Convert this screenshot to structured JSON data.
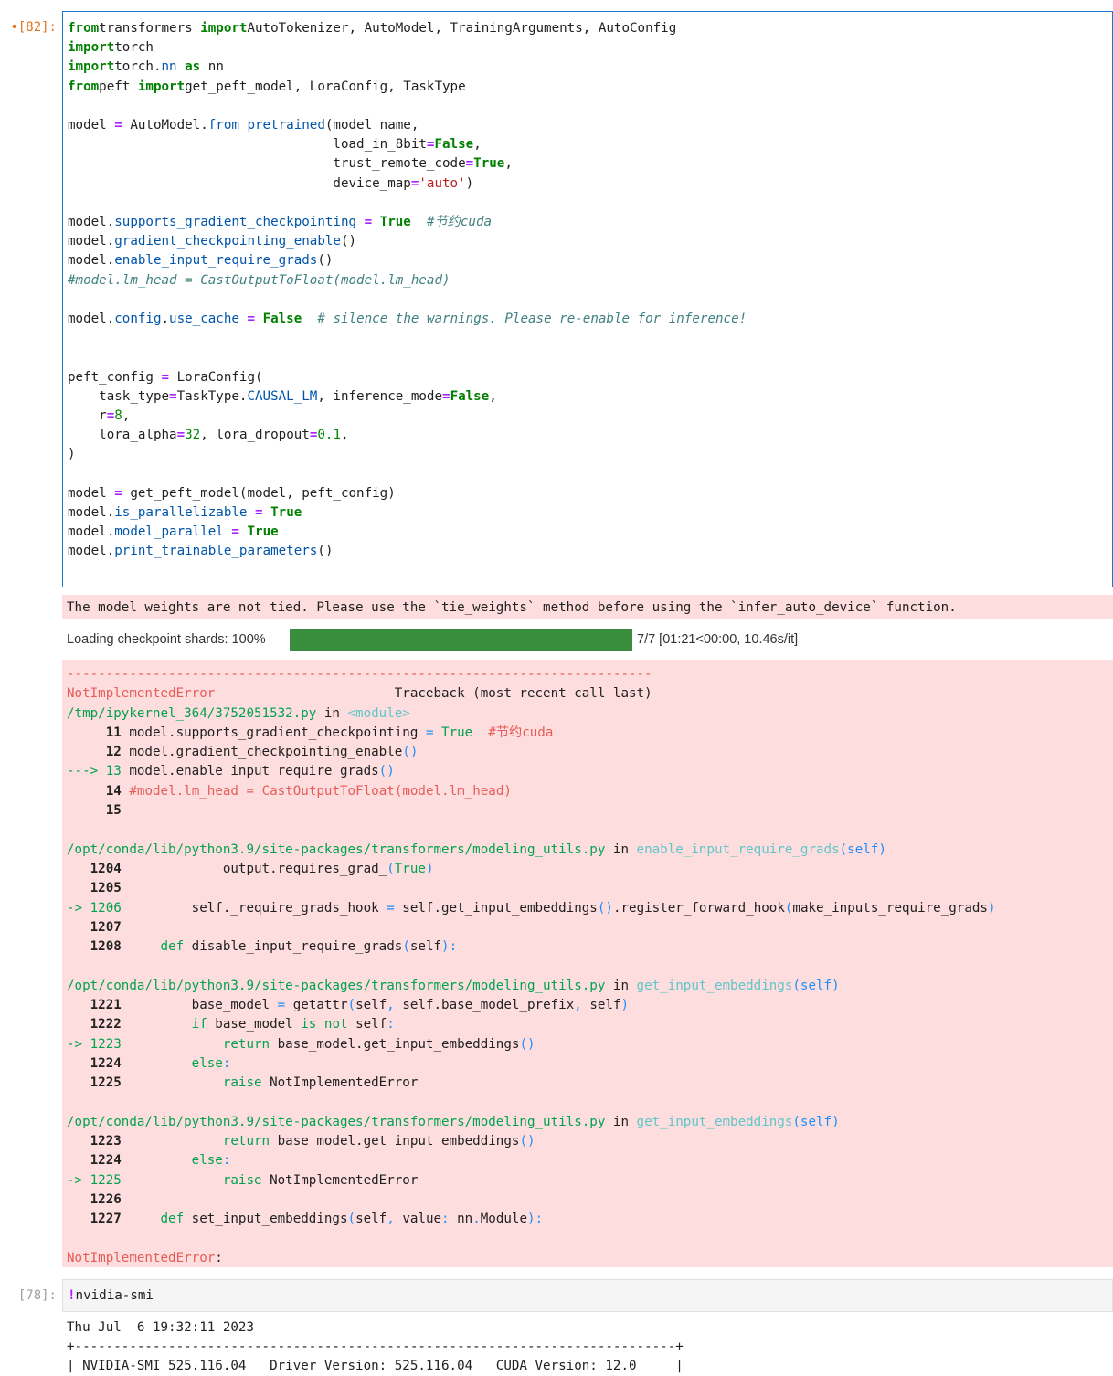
{
  "cell1": {
    "prompt": "[82]:",
    "lines": [
      [
        [
          "kw",
          "from"
        ],
        [
          "",
          "transformers "
        ],
        [
          "kw",
          "import"
        ],
        [
          "",
          "AutoTokenizer, AutoModel, TrainingArguments, AutoConfig"
        ]
      ],
      [
        [
          "kw",
          "import"
        ],
        [
          "",
          "torch"
        ]
      ],
      [
        [
          "kw",
          "import"
        ],
        [
          "",
          "torch."
        ],
        [
          "at",
          "nn"
        ],
        [
          "",
          " "
        ],
        [
          "kw",
          "as"
        ],
        [
          "",
          " nn"
        ]
      ],
      [
        [
          "kw",
          "from"
        ],
        [
          "",
          "peft "
        ],
        [
          "kw",
          "import"
        ],
        [
          "",
          "get_peft_model, LoraConfig, TaskType"
        ]
      ],
      [],
      [
        [
          "",
          "model "
        ],
        [
          "op",
          "="
        ],
        [
          "",
          " AutoModel."
        ],
        [
          "at",
          "from_pretrained"
        ],
        [
          "",
          "(model_name,"
        ]
      ],
      [
        [
          "",
          "                                  load_in_8bit"
        ],
        [
          "op",
          "="
        ],
        [
          "kw",
          "False"
        ],
        [
          "",
          ","
        ]
      ],
      [
        [
          "",
          "                                  trust_remote_code"
        ],
        [
          "op",
          "="
        ],
        [
          "kw",
          "True"
        ],
        [
          "",
          ","
        ]
      ],
      [
        [
          "",
          "                                  device_map"
        ],
        [
          "op",
          "="
        ],
        [
          "st",
          "'auto'"
        ],
        [
          "",
          ")"
        ]
      ],
      [],
      [
        [
          "",
          "model."
        ],
        [
          "at",
          "supports_gradient_checkpointing"
        ],
        [
          "",
          " "
        ],
        [
          "op",
          "="
        ],
        [
          "",
          " "
        ],
        [
          "kw",
          "True"
        ],
        [
          "",
          "  "
        ],
        [
          "cm",
          "#节约cuda"
        ]
      ],
      [
        [
          "",
          "model."
        ],
        [
          "at",
          "gradient_checkpointing_enable"
        ],
        [
          "",
          "()"
        ]
      ],
      [
        [
          "",
          "model."
        ],
        [
          "at",
          "enable_input_require_grads"
        ],
        [
          "",
          "()"
        ]
      ],
      [
        [
          "cm",
          "#model.lm_head = CastOutputToFloat(model.lm_head)"
        ]
      ],
      [],
      [
        [
          "",
          "model."
        ],
        [
          "at",
          "config"
        ],
        [
          "",
          "."
        ],
        [
          "at",
          "use_cache"
        ],
        [
          "",
          " "
        ],
        [
          "op",
          "="
        ],
        [
          "",
          " "
        ],
        [
          "kw",
          "False"
        ],
        [
          "",
          "  "
        ],
        [
          "cm",
          "# silence the warnings. Please re-enable for inference!"
        ]
      ],
      [],
      [],
      [
        [
          "",
          "peft_config "
        ],
        [
          "op",
          "="
        ],
        [
          "",
          " LoraConfig("
        ]
      ],
      [
        [
          "",
          "    task_type"
        ],
        [
          "op",
          "="
        ],
        [
          "",
          "TaskType."
        ],
        [
          "at",
          "CAUSAL_LM"
        ],
        [
          "",
          ", inference_mode"
        ],
        [
          "op",
          "="
        ],
        [
          "kw",
          "False"
        ],
        [
          "",
          ","
        ]
      ],
      [
        [
          "",
          "    r"
        ],
        [
          "op",
          "="
        ],
        [
          "nm",
          "8"
        ],
        [
          "",
          ","
        ]
      ],
      [
        [
          "",
          "    lora_alpha"
        ],
        [
          "op",
          "="
        ],
        [
          "nm",
          "32"
        ],
        [
          "",
          ", lora_dropout"
        ],
        [
          "op",
          "="
        ],
        [
          "nm",
          "0.1"
        ],
        [
          "",
          ","
        ]
      ],
      [
        [
          "",
          ")"
        ]
      ],
      [],
      [
        [
          "",
          "model "
        ],
        [
          "op",
          "="
        ],
        [
          "",
          " get_peft_model(model, peft_config)"
        ]
      ],
      [
        [
          "",
          "model."
        ],
        [
          "at",
          "is_parallelizable"
        ],
        [
          "",
          " "
        ],
        [
          "op",
          "="
        ],
        [
          "",
          " "
        ],
        [
          "kw",
          "True"
        ]
      ],
      [
        [
          "",
          "model."
        ],
        [
          "at",
          "model_parallel"
        ],
        [
          "",
          " "
        ],
        [
          "op",
          "="
        ],
        [
          "",
          " "
        ],
        [
          "kw",
          "True"
        ]
      ],
      [
        [
          "",
          "model."
        ],
        [
          "at",
          "print_trainable_parameters"
        ],
        [
          "",
          "()"
        ]
      ]
    ]
  },
  "warning": "The model weights are not tied. Please use the `tie_weights` method before using the `infer_auto_device` function.",
  "progress": {
    "label": "Loading checkpoint shards: 100%",
    "fraction": 1.0,
    "info": "7/7 [01:21<00:00, 10.46s/it]",
    "color": "#388e3c"
  },
  "traceback": {
    "lines": [
      [
        [
          "rd",
          "---------------------------------------------------------------------------"
        ]
      ],
      [
        [
          "rd",
          "NotImplementedError"
        ],
        [
          "pl",
          "                       Traceback (most recent call last)"
        ]
      ],
      [
        [
          "lg",
          "/tmp/ipykernel_364/3752051532.py"
        ],
        [
          "pl",
          " in "
        ],
        [
          "cy",
          "<module>"
        ]
      ],
      [
        [
          "pl",
          "     "
        ],
        [
          "bo",
          "11"
        ],
        [
          "pl",
          " model.supports_gradient_checkpointing "
        ],
        [
          "gn",
          "="
        ],
        [
          "pl",
          " "
        ],
        [
          "gr",
          "True"
        ],
        [
          "pl",
          "  "
        ],
        [
          "rd",
          "#节约cuda"
        ]
      ],
      [
        [
          "pl",
          "     "
        ],
        [
          "bo",
          "12"
        ],
        [
          "pl",
          " model.gradient_checkpointing_enable"
        ],
        [
          "gn",
          "()"
        ]
      ],
      [
        [
          "gr",
          "---> 13"
        ],
        [
          "pl",
          " model.enable_input_require_grads"
        ],
        [
          "gn",
          "()"
        ]
      ],
      [
        [
          "pl",
          "     "
        ],
        [
          "bo",
          "14"
        ],
        [
          "pl",
          " "
        ],
        [
          "rd",
          "#model.lm_head = CastOutputToFloat(model.lm_head)"
        ]
      ],
      [
        [
          "pl",
          "     "
        ],
        [
          "bo",
          "15"
        ]
      ],
      [],
      [
        [
          "lg",
          "/opt/conda/lib/python3.9/site-packages/transformers/modeling_utils.py"
        ],
        [
          "pl",
          " in "
        ],
        [
          "cy",
          "enable_input_require_grads"
        ],
        [
          "gn",
          "(self)"
        ]
      ],
      [
        [
          "pl",
          "   "
        ],
        [
          "bo",
          "1204"
        ],
        [
          "pl",
          "             output.requires_grad_"
        ],
        [
          "gn",
          "("
        ],
        [
          "gr",
          "True"
        ],
        [
          "gn",
          ")"
        ]
      ],
      [
        [
          "pl",
          "   "
        ],
        [
          "bo",
          "1205"
        ]
      ],
      [
        [
          "gr",
          "-> 1206"
        ],
        [
          "pl",
          "         self._require_grads_hook "
        ],
        [
          "gn",
          "="
        ],
        [
          "pl",
          " self.get_input_embeddings"
        ],
        [
          "gn",
          "()"
        ],
        [
          "pl",
          ".register_forward_hook"
        ],
        [
          "gn",
          "("
        ],
        [
          "pl",
          "make_inputs_require_grads"
        ],
        [
          "gn",
          ")"
        ]
      ],
      [
        [
          "pl",
          "   "
        ],
        [
          "bo",
          "1207"
        ]
      ],
      [
        [
          "pl",
          "   "
        ],
        [
          "bo",
          "1208"
        ],
        [
          "pl",
          "     "
        ],
        [
          "gr",
          "def"
        ],
        [
          "pl",
          " disable_input_require_grads"
        ],
        [
          "gn",
          "("
        ],
        [
          "pl",
          "self"
        ],
        [
          "gn",
          "):"
        ]
      ],
      [],
      [
        [
          "lg",
          "/opt/conda/lib/python3.9/site-packages/transformers/modeling_utils.py"
        ],
        [
          "pl",
          " in "
        ],
        [
          "cy",
          "get_input_embeddings"
        ],
        [
          "gn",
          "(self)"
        ]
      ],
      [
        [
          "pl",
          "   "
        ],
        [
          "bo",
          "1221"
        ],
        [
          "pl",
          "         base_model "
        ],
        [
          "gn",
          "="
        ],
        [
          "pl",
          " getattr"
        ],
        [
          "gn",
          "("
        ],
        [
          "pl",
          "self"
        ],
        [
          "gn",
          ","
        ],
        [
          "pl",
          " self.base_model_prefix"
        ],
        [
          "gn",
          ","
        ],
        [
          "pl",
          " self"
        ],
        [
          "gn",
          ")"
        ]
      ],
      [
        [
          "pl",
          "   "
        ],
        [
          "bo",
          "1222"
        ],
        [
          "pl",
          "         "
        ],
        [
          "gr",
          "if"
        ],
        [
          "pl",
          " base_model "
        ],
        [
          "gr",
          "is"
        ],
        [
          "pl",
          " "
        ],
        [
          "gr",
          "not"
        ],
        [
          "pl",
          " self"
        ],
        [
          "gn",
          ":"
        ]
      ],
      [
        [
          "gr",
          "-> 1223"
        ],
        [
          "pl",
          "             "
        ],
        [
          "gr",
          "return"
        ],
        [
          "pl",
          " base_model.get_input_embeddings"
        ],
        [
          "gn",
          "()"
        ]
      ],
      [
        [
          "pl",
          "   "
        ],
        [
          "bo",
          "1224"
        ],
        [
          "pl",
          "         "
        ],
        [
          "gr",
          "else"
        ],
        [
          "gn",
          ":"
        ]
      ],
      [
        [
          "pl",
          "   "
        ],
        [
          "bo",
          "1225"
        ],
        [
          "pl",
          "             "
        ],
        [
          "gr",
          "raise"
        ],
        [
          "pl",
          " NotImplementedError"
        ]
      ],
      [],
      [
        [
          "lg",
          "/opt/conda/lib/python3.9/site-packages/transformers/modeling_utils.py"
        ],
        [
          "pl",
          " in "
        ],
        [
          "cy",
          "get_input_embeddings"
        ],
        [
          "gn",
          "(self)"
        ]
      ],
      [
        [
          "pl",
          "   "
        ],
        [
          "bo",
          "1223"
        ],
        [
          "pl",
          "             "
        ],
        [
          "gr",
          "return"
        ],
        [
          "pl",
          " base_model.get_input_embeddings"
        ],
        [
          "gn",
          "()"
        ]
      ],
      [
        [
          "pl",
          "   "
        ],
        [
          "bo",
          "1224"
        ],
        [
          "pl",
          "         "
        ],
        [
          "gr",
          "else"
        ],
        [
          "gn",
          ":"
        ]
      ],
      [
        [
          "gr",
          "-> 1225"
        ],
        [
          "pl",
          "             "
        ],
        [
          "gr",
          "raise"
        ],
        [
          "pl",
          " NotImplementedError"
        ]
      ],
      [
        [
          "pl",
          "   "
        ],
        [
          "bo",
          "1226"
        ]
      ],
      [
        [
          "pl",
          "   "
        ],
        [
          "bo",
          "1227"
        ],
        [
          "pl",
          "     "
        ],
        [
          "gr",
          "def"
        ],
        [
          "pl",
          " set_input_embeddings"
        ],
        [
          "gn",
          "("
        ],
        [
          "pl",
          "self"
        ],
        [
          "gn",
          ","
        ],
        [
          "pl",
          " value"
        ],
        [
          "gn",
          ":"
        ],
        [
          "pl",
          " nn"
        ],
        [
          "gn",
          "."
        ],
        [
          "pl",
          "Module"
        ],
        [
          "gn",
          "):"
        ]
      ],
      [],
      [
        [
          "rd",
          "NotImplementedError"
        ],
        [
          "pl",
          ":"
        ]
      ]
    ]
  },
  "cell2": {
    "prompt": "[78]:",
    "lines": [
      [
        [
          "op",
          "!"
        ],
        [
          "",
          "nvidia-smi"
        ]
      ]
    ]
  },
  "output2": {
    "lines": [
      "Thu Jul  6 19:32:11 2023",
      "+-----------------------------------------------------------------------------+",
      "| NVIDIA-SMI 525.116.04   Driver Version: 525.116.04   CUDA Version: 12.0     |"
    ]
  }
}
